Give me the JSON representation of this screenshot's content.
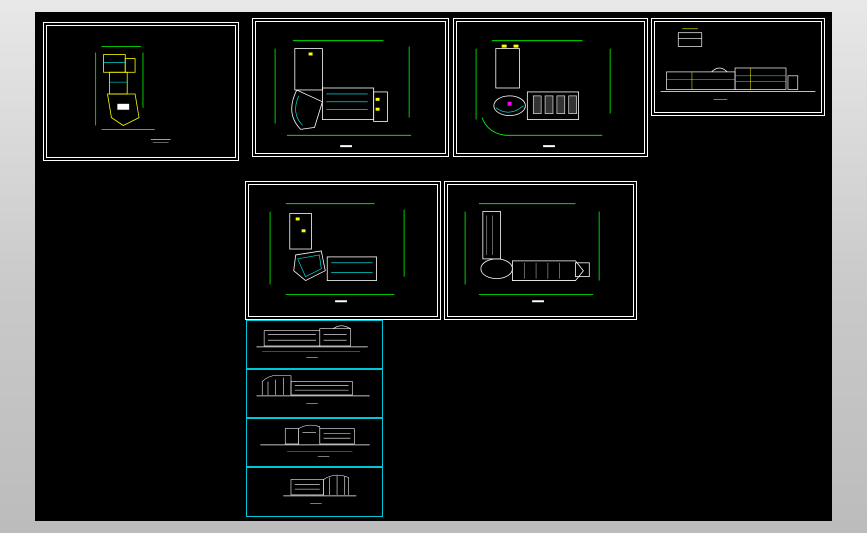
{
  "app": {
    "viewport": "cad-drawing-canvas"
  },
  "colors": {
    "background": "#000000",
    "frame": "#ffffff",
    "elevation_frame": "#00c8d8",
    "dimension_green": "#00ff00",
    "wall_white": "#ffffff",
    "highlight_yellow": "#ffff00",
    "hatch_cyan": "#00ffff",
    "accent_magenta": "#ff00ff",
    "window_chrome": "#c8c8c8"
  },
  "sheets": [
    {
      "id": "site-plan"
    },
    {
      "id": "first-floor-plan"
    },
    {
      "id": "second-floor-plan"
    },
    {
      "id": "elevation-section-overview"
    },
    {
      "id": "third-floor-plan"
    },
    {
      "id": "roof-plan"
    },
    {
      "id": "elevation-1"
    },
    {
      "id": "elevation-2"
    },
    {
      "id": "elevation-3"
    },
    {
      "id": "elevation-4"
    }
  ]
}
